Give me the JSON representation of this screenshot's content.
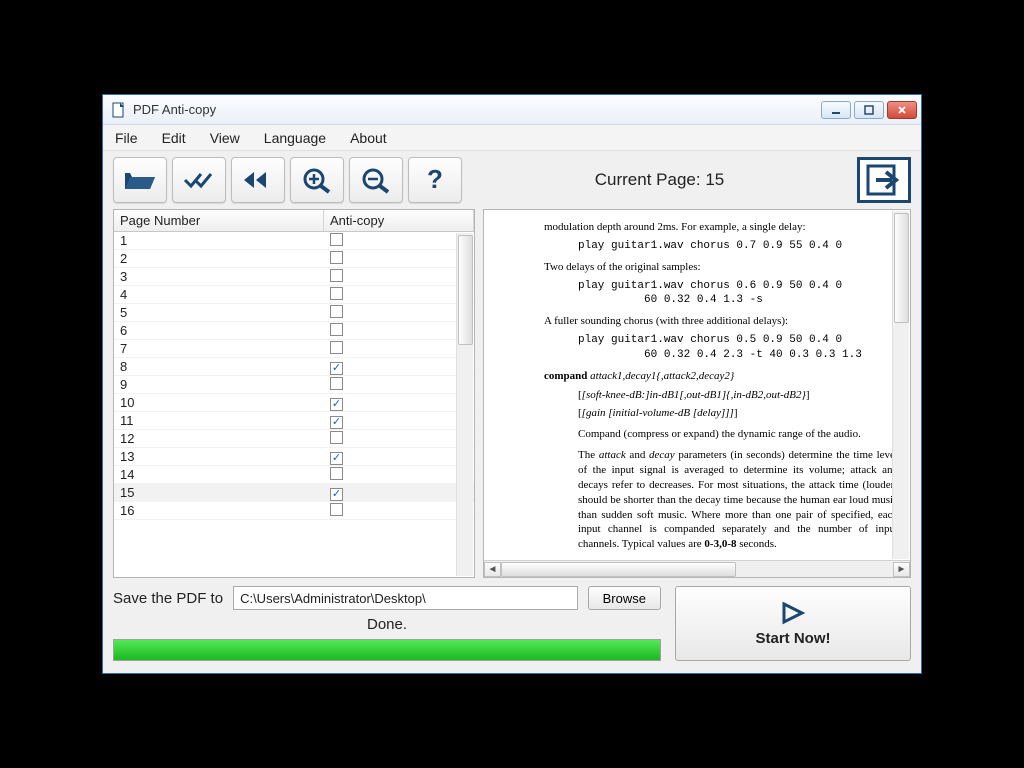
{
  "window": {
    "title": "PDF Anti-copy"
  },
  "menu": {
    "file": "File",
    "edit": "Edit",
    "view": "View",
    "language": "Language",
    "about": "About"
  },
  "current_page": {
    "label_prefix": "Current Page: ",
    "value": "15"
  },
  "list": {
    "col_page": "Page Number",
    "col_ac": "Anti-copy",
    "rows": [
      {
        "n": "1",
        "c": false
      },
      {
        "n": "2",
        "c": false
      },
      {
        "n": "3",
        "c": false
      },
      {
        "n": "4",
        "c": false
      },
      {
        "n": "5",
        "c": false
      },
      {
        "n": "6",
        "c": false
      },
      {
        "n": "7",
        "c": false
      },
      {
        "n": "8",
        "c": true
      },
      {
        "n": "9",
        "c": false
      },
      {
        "n": "10",
        "c": true
      },
      {
        "n": "11",
        "c": true
      },
      {
        "n": "12",
        "c": false
      },
      {
        "n": "13",
        "c": true
      },
      {
        "n": "14",
        "c": false
      },
      {
        "n": "15",
        "c": true
      },
      {
        "n": "16",
        "c": false
      }
    ],
    "selected": "15"
  },
  "preview": {
    "l1": "modulation depth around 2ms.  For example, a single delay:",
    "c1": "play guitar1.wav chorus 0.7 0.9 55 0.4 0",
    "l2": "Two delays of the original samples:",
    "c2": "play guitar1.wav chorus 0.6 0.9 50 0.4 0\n          60 0.32 0.4 1.3 -s",
    "l3": "A fuller sounding chorus (with three additional delays):",
    "c3": "play guitar1.wav chorus 0.5 0.9 50 0.4 0\n          60 0.32 0.4 2.3 -t 40 0.3 0.3 1.3",
    "compand_head": "compand",
    "compand_args": "attack1,decay1{,attack2,decay2}",
    "compand_l2": "[soft-knee-dB:]in-dB1[,out-dB1]{,in-dB2,out-dB2}",
    "compand_l3": "[gain [initial-volume-dB [delay]]]",
    "l4": "Compand (compress or expand) the dynamic range of the audio.",
    "l5a": "The ",
    "l5b": "attack",
    "l5c": " and ",
    "l5d": "decay",
    "l5e": " parameters (in seconds) determine the time level of the input signal is averaged to determine its volume; attack and decays refer to decreases.  For most situations, the attack time (louder) should be shorter than the decay time because the human ear loud music than sudden soft music.  Where more than one pair of specified, each input channel is companded separately and the number of input channels.  Typical values are ",
    "l5f": "0-3,0-8",
    "l5g": " seconds."
  },
  "save": {
    "label": "Save the PDF to",
    "path": "C:\\Users\\Administrator\\Desktop\\",
    "browse": "Browse"
  },
  "status": "Done.",
  "progress_pct": 100,
  "start_label": "Start Now!"
}
